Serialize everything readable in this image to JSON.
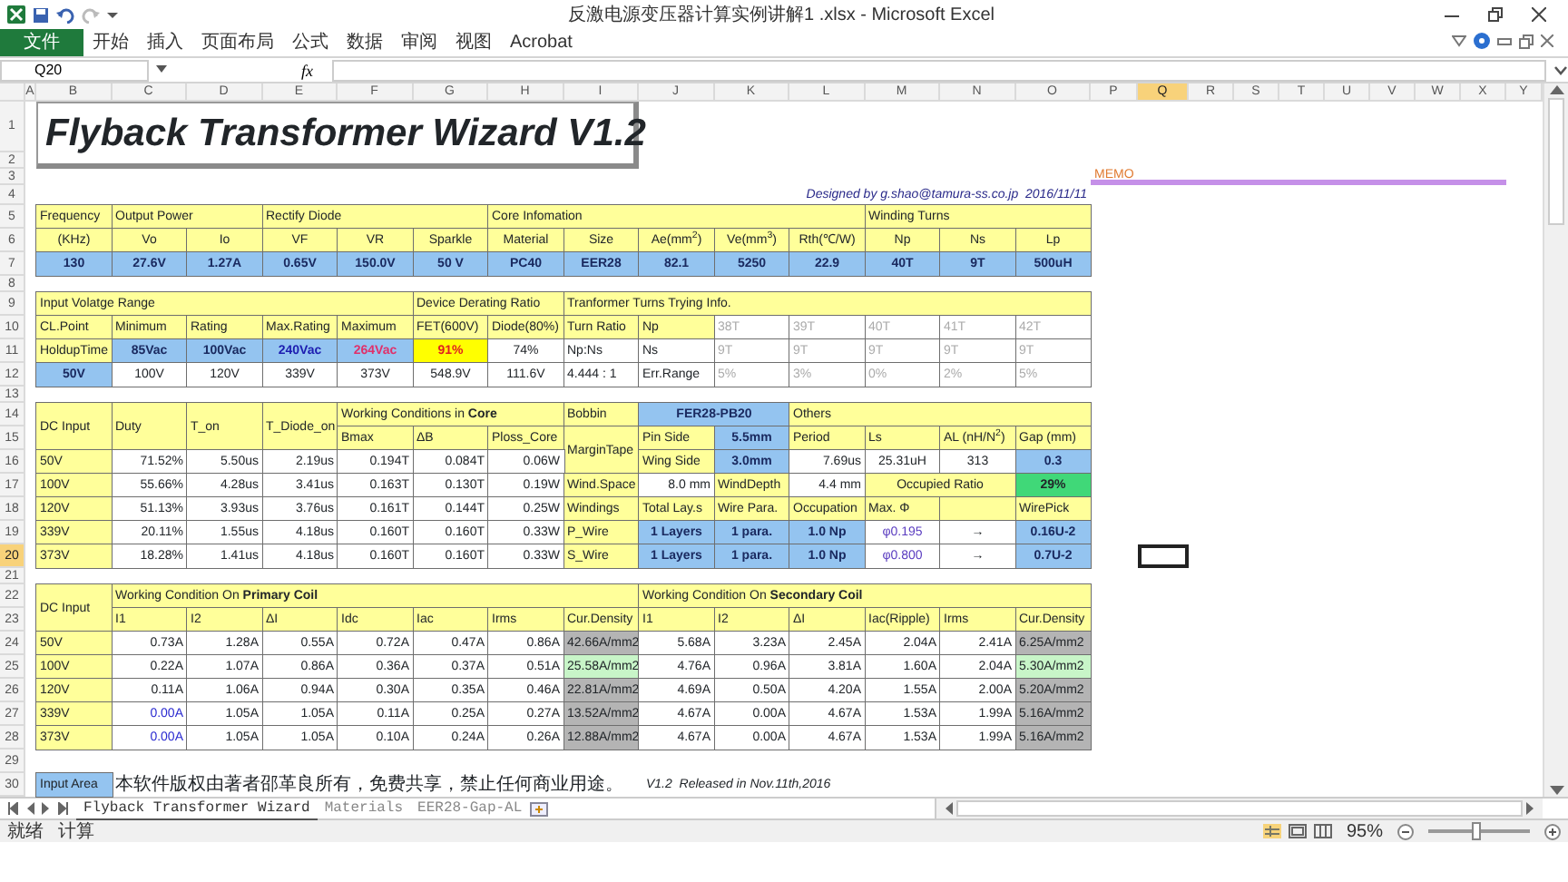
{
  "window": {
    "title": "反激电源变压器计算实例讲解1 .xlsx - Microsoft Excel"
  },
  "ribbon_tabs": [
    {
      "label": "文件",
      "kind": "file",
      "selected": false
    },
    {
      "label": "开始",
      "kind": "tab",
      "selected": false
    },
    {
      "label": "插入",
      "kind": "tab",
      "selected": false
    },
    {
      "label": "页面布局",
      "kind": "tab",
      "selected": false
    },
    {
      "label": "公式",
      "kind": "tab",
      "selected": false
    },
    {
      "label": "数据",
      "kind": "tab",
      "selected": false
    },
    {
      "label": "审阅",
      "kind": "tab",
      "selected": false
    },
    {
      "label": "视图",
      "kind": "tab",
      "selected": false
    },
    {
      "label": "Acrobat",
      "kind": "tab",
      "selected": false
    }
  ],
  "formula_bar": {
    "name_box": "Q20",
    "fx": "fx"
  },
  "column_headers": [
    {
      "label": "A",
      "selected": false
    },
    {
      "label": "B",
      "selected": false
    },
    {
      "label": "C",
      "selected": false
    },
    {
      "label": "D",
      "selected": false
    },
    {
      "label": "E",
      "selected": false
    },
    {
      "label": "F",
      "selected": false
    },
    {
      "label": "G",
      "selected": false
    },
    {
      "label": "H",
      "selected": false
    },
    {
      "label": "I",
      "selected": false
    },
    {
      "label": "J",
      "selected": false
    },
    {
      "label": "K",
      "selected": false
    },
    {
      "label": "L",
      "selected": false
    },
    {
      "label": "M",
      "selected": false
    },
    {
      "label": "N",
      "selected": false
    },
    {
      "label": "O",
      "selected": false
    },
    {
      "label": "P",
      "selected": false
    },
    {
      "label": "Q",
      "selected": true
    },
    {
      "label": "R",
      "selected": false
    },
    {
      "label": "S",
      "selected": false
    },
    {
      "label": "T",
      "selected": false
    },
    {
      "label": "U",
      "selected": false
    },
    {
      "label": "V",
      "selected": false
    },
    {
      "label": "W",
      "selected": false
    },
    {
      "label": "X",
      "selected": false
    },
    {
      "label": "Y",
      "selected": false
    }
  ],
  "row_headers": [
    {
      "label": "1",
      "selected": false
    },
    {
      "label": "2",
      "selected": false
    },
    {
      "label": "3",
      "selected": false
    },
    {
      "label": "4",
      "selected": false
    },
    {
      "label": "5",
      "selected": false
    },
    {
      "label": "6",
      "selected": false
    },
    {
      "label": "7",
      "selected": false
    },
    {
      "label": "8",
      "selected": false
    },
    {
      "label": "9",
      "selected": false
    },
    {
      "label": "10",
      "selected": false
    },
    {
      "label": "11",
      "selected": false
    },
    {
      "label": "12",
      "selected": false
    },
    {
      "label": "13",
      "selected": false
    },
    {
      "label": "14",
      "selected": false
    },
    {
      "label": "15",
      "selected": false
    },
    {
      "label": "16",
      "selected": false
    },
    {
      "label": "17",
      "selected": false
    },
    {
      "label": "18",
      "selected": false
    },
    {
      "label": "19",
      "selected": false
    },
    {
      "label": "20",
      "selected": true
    },
    {
      "label": "21",
      "selected": false
    },
    {
      "label": "22",
      "selected": false
    },
    {
      "label": "23",
      "selected": false
    },
    {
      "label": "24",
      "selected": false
    },
    {
      "label": "25",
      "selected": false
    },
    {
      "label": "26",
      "selected": false
    },
    {
      "label": "27",
      "selected": false
    },
    {
      "label": "28",
      "selected": false
    },
    {
      "label": "29",
      "selected": false
    },
    {
      "label": "30",
      "selected": false
    }
  ],
  "cells": [
    {
      "text": "Flyback Transformer Wizard V1.2",
      "kind": "title"
    },
    {
      "text": "MEMO",
      "kind": "memo"
    },
    {
      "text": "Designed by g.shao@tamura-ss.co.jp  2016/11/11",
      "kind": "credit"
    },
    {
      "text": "Frequency",
      "kind": "label"
    },
    {
      "text": "Output Power",
      "kind": "label"
    },
    {
      "text": "Rectify Diode",
      "kind": "label"
    },
    {
      "text": "Core Infomation",
      "kind": "label"
    },
    {
      "text": "Winding Turns",
      "kind": "label"
    },
    {
      "text": "(KHz)",
      "kind": "hcenter"
    },
    {
      "text": "Vo",
      "kind": "hcenter"
    },
    {
      "text": "Io",
      "kind": "hcenter"
    },
    {
      "text": "VF",
      "kind": "hcenter"
    },
    {
      "text": "VR",
      "kind": "hcenter"
    },
    {
      "text": "Sparkle",
      "kind": "hcenter"
    },
    {
      "text": "Material",
      "kind": "hcenter"
    },
    {
      "text": "Size",
      "kind": "hcenter"
    },
    {
      "text": "Ae(mm$^{2}$)",
      "kind": "hcenter"
    },
    {
      "text": "Ve(mm$^{3}$)",
      "kind": "hcenter"
    },
    {
      "text": "Rth(℃/W)",
      "kind": "hcenter"
    },
    {
      "text": "Np",
      "kind": "hcenter"
    },
    {
      "text": "Ns",
      "kind": "hcenter"
    },
    {
      "text": "Lp",
      "kind": "hcenter"
    },
    {
      "text": "130",
      "kind": "in"
    },
    {
      "text": "27.6V",
      "kind": "in"
    },
    {
      "text": "1.27A",
      "kind": "in"
    },
    {
      "text": "0.65V",
      "kind": "in"
    },
    {
      "text": "150.0V",
      "kind": "in"
    },
    {
      "text": "50 V",
      "kind": "in"
    },
    {
      "text": "PC40",
      "kind": "in"
    },
    {
      "text": "EER28",
      "kind": "in"
    },
    {
      "text": "82.1",
      "kind": "in"
    },
    {
      "text": "5250",
      "kind": "in"
    },
    {
      "text": "22.9",
      "kind": "in"
    },
    {
      "text": "40T",
      "kind": "in"
    },
    {
      "text": "9T",
      "kind": "in"
    },
    {
      "text": "500uH",
      "kind": "in"
    },
    {
      "text": "Input Volatge Range",
      "kind": "label"
    },
    {
      "text": "Device Derating Ratio",
      "kind": "label"
    },
    {
      "text": "Tranformer Turns Trying Info.",
      "kind": "label"
    },
    {
      "text": "CL.Point",
      "kind": "label"
    },
    {
      "text": "Minimum",
      "kind": "label"
    },
    {
      "text": "Rating",
      "kind": "label"
    },
    {
      "text": "Max.Rating",
      "kind": "label"
    },
    {
      "text": "Maximum",
      "kind": "label"
    },
    {
      "text": "FET(600V)",
      "kind": "label"
    },
    {
      "text": "Diode(80%)",
      "kind": "label"
    },
    {
      "text": "Turn Ratio",
      "kind": "label"
    },
    {
      "text": "Np",
      "kind": "label"
    },
    {
      "text": "38T",
      "kind": "dim"
    },
    {
      "text": "39T",
      "kind": "dim"
    },
    {
      "text": "40T",
      "kind": "dim"
    },
    {
      "text": "41T",
      "kind": "dim"
    },
    {
      "text": "42T",
      "kind": "dim"
    },
    {
      "text": "HoldupTime",
      "kind": "label"
    },
    {
      "text": "85Vac",
      "kind": "in"
    },
    {
      "text": "100Vac",
      "kind": "in"
    },
    {
      "text": "240Vac",
      "kind": "in",
      "color": "#1c1cb0"
    },
    {
      "text": "264Vac",
      "kind": "in",
      "color": "#e0306a"
    },
    {
      "text": "91%",
      "kind": "hot",
      "color": "#e02020"
    },
    {
      "text": "74%",
      "kind": "out"
    },
    {
      "text": "Np:Ns",
      "kind": "left"
    },
    {
      "text": "Ns",
      "kind": "left"
    },
    {
      "text": "9T",
      "kind": "dim"
    },
    {
      "text": "9T",
      "kind": "dim"
    },
    {
      "text": "9T",
      "kind": "dim"
    },
    {
      "text": "9T",
      "kind": "dim"
    },
    {
      "text": "9T",
      "kind": "dim"
    },
    {
      "text": "50V",
      "kind": "in"
    },
    {
      "text": "100V",
      "kind": "out"
    },
    {
      "text": "120V",
      "kind": "out"
    },
    {
      "text": "339V",
      "kind": "out"
    },
    {
      "text": "373V",
      "kind": "out"
    },
    {
      "text": "548.9V",
      "kind": "out"
    },
    {
      "text": "111.6V",
      "kind": "out"
    },
    {
      "text": "4.444 : 1",
      "kind": "left"
    },
    {
      "text": "Err.Range",
      "kind": "left"
    },
    {
      "text": "5%",
      "kind": "dim"
    },
    {
      "text": "3%",
      "kind": "dim"
    },
    {
      "text": "0%",
      "kind": "dim"
    },
    {
      "text": "2%",
      "kind": "dim"
    },
    {
      "text": "5%",
      "kind": "dim"
    },
    {
      "text": "DC Input",
      "kind": "label"
    },
    {
      "text": "Duty",
      "kind": "label"
    },
    {
      "text": "T_on",
      "kind": "label"
    },
    {
      "text": "T_Diode_on",
      "kind": "label"
    },
    {
      "text": "Working Conditions in **Core**",
      "kind": "label"
    },
    {
      "text": "Bobbin",
      "kind": "label"
    },
    {
      "text": "FER28-PB20",
      "kind": "in"
    },
    {
      "text": "Others",
      "kind": "label"
    },
    {
      "text": "Bmax",
      "kind": "label"
    },
    {
      "text": "ΔB",
      "kind": "label"
    },
    {
      "text": "Ploss_Core",
      "kind": "label"
    },
    {
      "text": "MarginTape",
      "kind": "label"
    },
    {
      "text": "Pin Side",
      "kind": "label"
    },
    {
      "text": "5.5mm",
      "kind": "in"
    },
    {
      "text": "Period",
      "kind": "label"
    },
    {
      "text": "Ls",
      "kind": "label"
    },
    {
      "text": "AL (nH/N$^{2}$)",
      "kind": "label"
    },
    {
      "text": "Gap (mm)",
      "kind": "label"
    },
    {
      "text": "50V",
      "kind": "label"
    },
    {
      "text": "71.52%",
      "kind": "num"
    },
    {
      "text": "5.50us",
      "kind": "num"
    },
    {
      "text": "2.19us",
      "kind": "num"
    },
    {
      "text": "0.194T",
      "kind": "num"
    },
    {
      "text": "0.084T",
      "kind": "num"
    },
    {
      "text": "0.06W",
      "kind": "num"
    },
    {
      "text": "Wing Side",
      "kind": "label"
    },
    {
      "text": "3.0mm",
      "kind": "in"
    },
    {
      "text": "7.69us",
      "kind": "num"
    },
    {
      "text": "25.31uH",
      "kind": "out"
    },
    {
      "text": "313",
      "kind": "out"
    },
    {
      "text": "0.3",
      "kind": "in"
    },
    {
      "text": "100V",
      "kind": "label"
    },
    {
      "text": "55.66%",
      "kind": "num"
    },
    {
      "text": "4.28us",
      "kind": "num"
    },
    {
      "text": "3.41us",
      "kind": "num"
    },
    {
      "text": "0.163T",
      "kind": "num"
    },
    {
      "text": "0.130T",
      "kind": "num"
    },
    {
      "text": "0.19W",
      "kind": "num"
    },
    {
      "text": "Wind.Space",
      "kind": "label"
    },
    {
      "text": "8.0 mm",
      "kind": "num"
    },
    {
      "text": "WindDepth",
      "kind": "label"
    },
    {
      "text": "4.4 mm",
      "kind": "num"
    },
    {
      "text": "Occupied Ratio",
      "kind": "hcenter"
    },
    {
      "text": "29%",
      "kind": "ok"
    },
    {
      "text": "120V",
      "kind": "label"
    },
    {
      "text": "51.13%",
      "kind": "num"
    },
    {
      "text": "3.93us",
      "kind": "num"
    },
    {
      "text": "3.76us",
      "kind": "num"
    },
    {
      "text": "0.161T",
      "kind": "num"
    },
    {
      "text": "0.144T",
      "kind": "num"
    },
    {
      "text": "0.25W",
      "kind": "num"
    },
    {
      "text": "Windings",
      "kind": "label"
    },
    {
      "text": "Total Lay.s",
      "kind": "label"
    },
    {
      "text": "Wire Para.",
      "kind": "label"
    },
    {
      "text": "Occupation",
      "kind": "label"
    },
    {
      "text": "Max. Φ",
      "kind": "label"
    },
    {
      "kind": "label"
    },
    {
      "text": "WirePick",
      "kind": "label"
    },
    {
      "text": "339V",
      "kind": "label"
    },
    {
      "text": "20.11%",
      "kind": "num"
    },
    {
      "text": "1.55us",
      "kind": "num"
    },
    {
      "text": "4.18us",
      "kind": "num"
    },
    {
      "text": "0.160T",
      "kind": "num"
    },
    {
      "text": "0.160T",
      "kind": "num"
    },
    {
      "text": "0.33W",
      "kind": "num"
    },
    {
      "text": "P_Wire",
      "kind": "label"
    },
    {
      "text": "1 Layers",
      "kind": "in"
    },
    {
      "text": "1 para.",
      "kind": "in"
    },
    {
      "text": "1.0 Np",
      "kind": "in"
    },
    {
      "text": "φ0.195",
      "kind": "out",
      "color": "#5a3cc0"
    },
    {
      "text": "→",
      "kind": "out"
    },
    {
      "text": "0.16U-2",
      "kind": "in"
    },
    {
      "text": "373V",
      "kind": "label"
    },
    {
      "text": "18.28%",
      "kind": "num"
    },
    {
      "text": "1.41us",
      "kind": "num"
    },
    {
      "text": "4.18us",
      "kind": "num"
    },
    {
      "text": "0.160T",
      "kind": "num"
    },
    {
      "text": "0.160T",
      "kind": "num"
    },
    {
      "text": "0.33W",
      "kind": "num"
    },
    {
      "text": "S_Wire",
      "kind": "label"
    },
    {
      "text": "1 Layers",
      "kind": "in"
    },
    {
      "text": "1 para.",
      "kind": "in"
    },
    {
      "text": "1.0 Np",
      "kind": "in"
    },
    {
      "text": "φ0.800",
      "kind": "out",
      "color": "#5a3cc0"
    },
    {
      "text": "→",
      "kind": "out"
    },
    {
      "text": "0.7U-2",
      "kind": "in"
    },
    {
      "text": "DC Input",
      "kind": "label"
    },
    {
      "text": "Working Condition On **Primary Coil**",
      "kind": "label"
    },
    {
      "text": "Working Condition On **Secondary Coil**",
      "kind": "label"
    },
    {
      "text": "I1",
      "kind": "label"
    },
    {
      "text": "I2",
      "kind": "label"
    },
    {
      "text": "ΔI",
      "kind": "label"
    },
    {
      "text": "Idc",
      "kind": "label"
    },
    {
      "text": "Iac",
      "kind": "label"
    },
    {
      "text": "Irms",
      "kind": "label"
    },
    {
      "text": "Cur.Density",
      "kind": "label"
    },
    {
      "text": "I1",
      "kind": "label"
    },
    {
      "text": "I2",
      "kind": "label"
    },
    {
      "text": "ΔI",
      "kind": "label"
    },
    {
      "text": "Iac(Ripple)",
      "kind": "label"
    },
    {
      "text": "Irms",
      "kind": "label"
    },
    {
      "text": "Cur.Density",
      "kind": "label"
    },
    {
      "text": "50V",
      "kind": "label"
    },
    {
      "text": "0.73A",
      "kind": "num"
    },
    {
      "text": "1.28A",
      "kind": "num"
    },
    {
      "text": "0.55A",
      "kind": "num"
    },
    {
      "text": "0.72A",
      "kind": "num"
    },
    {
      "text": "0.47A",
      "kind": "num"
    },
    {
      "text": "0.86A",
      "kind": "num"
    },
    {
      "text": "42.66A/mm2",
      "kind": "dens"
    },
    {
      "text": "5.68A",
      "kind": "num"
    },
    {
      "text": "3.23A",
      "kind": "num"
    },
    {
      "text": "2.45A",
      "kind": "num"
    },
    {
      "text": "2.04A",
      "kind": "num"
    },
    {
      "text": "2.41A",
      "kind": "num"
    },
    {
      "text": "6.25A/mm2",
      "kind": "dens"
    },
    {
      "text": "100V",
      "kind": "label"
    },
    {
      "text": "0.22A",
      "kind": "num"
    },
    {
      "text": "1.07A",
      "kind": "num"
    },
    {
      "text": "0.86A",
      "kind": "num"
    },
    {
      "text": "0.36A",
      "kind": "num"
    },
    {
      "text": "0.37A",
      "kind": "num"
    },
    {
      "text": "0.51A",
      "kind": "num"
    },
    {
      "text": "25.58A/mm2",
      "kind": "densok"
    },
    {
      "text": "4.76A",
      "kind": "num"
    },
    {
      "text": "0.96A",
      "kind": "num"
    },
    {
      "text": "3.81A",
      "kind": "num"
    },
    {
      "text": "1.60A",
      "kind": "num"
    },
    {
      "text": "2.04A",
      "kind": "num"
    },
    {
      "text": "5.30A/mm2",
      "kind": "densok"
    },
    {
      "text": "120V",
      "kind": "label"
    },
    {
      "text": "0.11A",
      "kind": "num"
    },
    {
      "text": "1.06A",
      "kind": "num"
    },
    {
      "text": "0.94A",
      "kind": "num"
    },
    {
      "text": "0.30A",
      "kind": "num"
    },
    {
      "text": "0.35A",
      "kind": "num"
    },
    {
      "text": "0.46A",
      "kind": "num"
    },
    {
      "text": "22.81A/mm2",
      "kind": "dens"
    },
    {
      "text": "4.69A",
      "kind": "num"
    },
    {
      "text": "0.50A",
      "kind": "num"
    },
    {
      "text": "4.20A",
      "kind": "num"
    },
    {
      "text": "1.55A",
      "kind": "num"
    },
    {
      "text": "2.00A",
      "kind": "num"
    },
    {
      "text": "5.20A/mm2",
      "kind": "dens"
    },
    {
      "text": "339V",
      "kind": "label"
    },
    {
      "text": "0.00A",
      "kind": "num",
      "color": "#2a2ad0"
    },
    {
      "text": "1.05A",
      "kind": "num"
    },
    {
      "text": "1.05A",
      "kind": "num"
    },
    {
      "text": "0.11A",
      "kind": "num"
    },
    {
      "text": "0.25A",
      "kind": "num"
    },
    {
      "text": "0.27A",
      "kind": "num"
    },
    {
      "text": "13.52A/mm2",
      "kind": "dens"
    },
    {
      "text": "4.67A",
      "kind": "num"
    },
    {
      "text": "0.00A",
      "kind": "num"
    },
    {
      "text": "4.67A",
      "kind": "num"
    },
    {
      "text": "1.53A",
      "kind": "num"
    },
    {
      "text": "1.99A",
      "kind": "num"
    },
    {
      "text": "5.16A/mm2",
      "kind": "dens"
    },
    {
      "text": "373V",
      "kind": "label"
    },
    {
      "text": "0.00A",
      "kind": "num",
      "color": "#2a2ad0"
    },
    {
      "text": "1.05A",
      "kind": "num"
    },
    {
      "text": "1.05A",
      "kind": "num"
    },
    {
      "text": "0.10A",
      "kind": "num"
    },
    {
      "text": "0.24A",
      "kind": "num"
    },
    {
      "text": "0.26A",
      "kind": "num"
    },
    {
      "text": "12.88A/mm2",
      "kind": "dens"
    },
    {
      "text": "4.67A",
      "kind": "num"
    },
    {
      "text": "0.00A",
      "kind": "num"
    },
    {
      "text": "4.67A",
      "kind": "num"
    },
    {
      "text": "1.53A",
      "kind": "num"
    },
    {
      "text": "1.99A",
      "kind": "num"
    },
    {
      "text": "5.16A/mm2",
      "kind": "dens"
    },
    {
      "text": "Input Area",
      "kind": "legend"
    },
    {
      "text": "本软件版权由著者邵革良所有，免费共享，禁止任何商业用途。",
      "kind": "note"
    },
    {
      "text": "V1.2  Released in Nov.11th,2016",
      "kind": "release"
    }
  ],
  "sheet_tabs": [
    {
      "label": "Flyback Transformer Wizard",
      "selected": true
    },
    {
      "label": "Materials",
      "selected": false
    },
    {
      "label": "EER28-Gap-AL",
      "selected": false
    }
  ],
  "status_bar": {
    "items": [
      "就绪",
      "计算"
    ],
    "zoom": "95%",
    "zoom_slider": {
      "level": 0.47
    }
  }
}
